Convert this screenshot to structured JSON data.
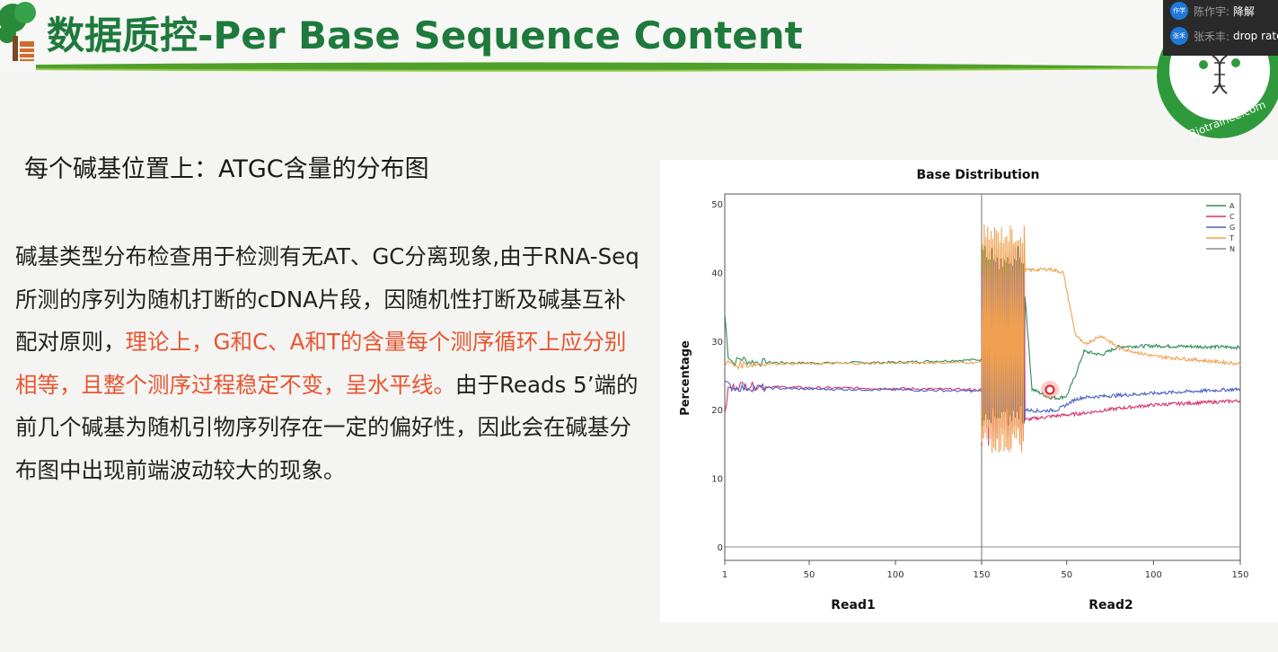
{
  "slide": {
    "title": "数据质控-Per Base Sequence Content",
    "subtitle": "每个碱基位置上：ATGC含量的分布图",
    "paragraph": {
      "part1": "碱基类型分布检查用于检测有无AT、GC分离现象,由于RNA-Seq所测的序列为随机打断的cDNA片段，因随机性打断及碱基互补配对原则，",
      "part2_red": "理论上，G和C、A和T的含量每个测序循环上应分别相等，且整个测序过程稳定不变，呈水平线。",
      "part3": "由于Reads 5’端的前几个碱基为随机引物序列存在一定的偏好性，因此会在碱基分布图中出现前端波动较大的现象。"
    },
    "logo_text": "Biotrainee.com"
  },
  "chat": {
    "messages": [
      {
        "avatar": "作学",
        "name": "陈作宇:",
        "text": "降解"
      },
      {
        "avatar": "张禾",
        "name": "张禾丰:",
        "text": "drop rate"
      }
    ]
  },
  "colors": {
    "title_green": "#1e7a3c",
    "highlight_red": "#e8552f",
    "A": "#2e8b57",
    "C": "#d6336c",
    "G": "#4a5fc1",
    "T": "#f0a050",
    "N": "#888888"
  },
  "chart_data": {
    "type": "line",
    "title": "Base Distribution",
    "ylabel": "Percentage",
    "xlabel_left": "Read1",
    "xlabel_right": "Read2",
    "ylim": [
      0,
      50
    ],
    "yticks": [
      0,
      10,
      20,
      30,
      40,
      50
    ],
    "read1_ticks": [
      1,
      50,
      100,
      150
    ],
    "read2_ticks": [
      50,
      100,
      150
    ],
    "legend": [
      "A",
      "C",
      "G",
      "T",
      "N"
    ],
    "legend_position": "top-right",
    "series": [
      {
        "name": "A",
        "read1": [
          [
            1,
            34
          ],
          [
            3,
            28
          ],
          [
            6,
            26.8
          ],
          [
            10,
            27.5
          ],
          [
            15,
            27
          ],
          [
            20,
            26.9
          ],
          [
            50,
            26.8
          ],
          [
            100,
            26.9
          ],
          [
            150,
            27.3
          ]
        ],
        "read2": [
          [
            1,
            48
          ],
          [
            12,
            44
          ],
          [
            25,
            40
          ],
          [
            30,
            23
          ],
          [
            40,
            21.8
          ],
          [
            45,
            21.7
          ],
          [
            50,
            22
          ],
          [
            55,
            25
          ],
          [
            60,
            28.5
          ],
          [
            70,
            28
          ],
          [
            80,
            29.2
          ],
          [
            100,
            29.3
          ],
          [
            150,
            29.1
          ]
        ]
      },
      {
        "name": "C",
        "read1": [
          [
            1,
            19
          ],
          [
            3,
            23
          ],
          [
            6,
            23.3
          ],
          [
            10,
            23.6
          ],
          [
            20,
            23.4
          ],
          [
            50,
            23.2
          ],
          [
            100,
            23.1
          ],
          [
            150,
            22.9
          ]
        ],
        "read2": [
          [
            1,
            13
          ],
          [
            12,
            18
          ],
          [
            25,
            18.5
          ],
          [
            40,
            19
          ],
          [
            60,
            19.5
          ],
          [
            80,
            20.2
          ],
          [
            100,
            20.7
          ],
          [
            150,
            21.3
          ]
        ]
      },
      {
        "name": "G",
        "read1": [
          [
            1,
            24
          ],
          [
            3,
            23.5
          ],
          [
            6,
            23.2
          ],
          [
            20,
            23.2
          ],
          [
            50,
            23
          ],
          [
            100,
            22.9
          ],
          [
            150,
            22.7
          ]
        ],
        "read2": [
          [
            1,
            21
          ],
          [
            12,
            19
          ],
          [
            25,
            20
          ],
          [
            35,
            19.8
          ],
          [
            45,
            20
          ],
          [
            55,
            21.5
          ],
          [
            60,
            21.8
          ],
          [
            80,
            22.1
          ],
          [
            100,
            22.4
          ],
          [
            150,
            23
          ]
        ]
      },
      {
        "name": "T",
        "read1": [
          [
            1,
            26
          ],
          [
            3,
            27
          ],
          [
            6,
            26.5
          ],
          [
            20,
            26.7
          ],
          [
            50,
            26.7
          ],
          [
            100,
            26.8
          ],
          [
            150,
            26.9
          ]
        ],
        "read2": [
          [
            1,
            30
          ],
          [
            12,
            38
          ],
          [
            25,
            40.3
          ],
          [
            40,
            40.5
          ],
          [
            48,
            40
          ],
          [
            55,
            31
          ],
          [
            60,
            29.5
          ],
          [
            70,
            30.8
          ],
          [
            80,
            29
          ],
          [
            100,
            27.8
          ],
          [
            150,
            26.7
          ]
        ]
      },
      {
        "name": "N",
        "read1": [
          [
            1,
            0
          ],
          [
            150,
            0
          ]
        ],
        "read2": [
          [
            1,
            0
          ],
          [
            150,
            0
          ]
        ]
      }
    ]
  }
}
